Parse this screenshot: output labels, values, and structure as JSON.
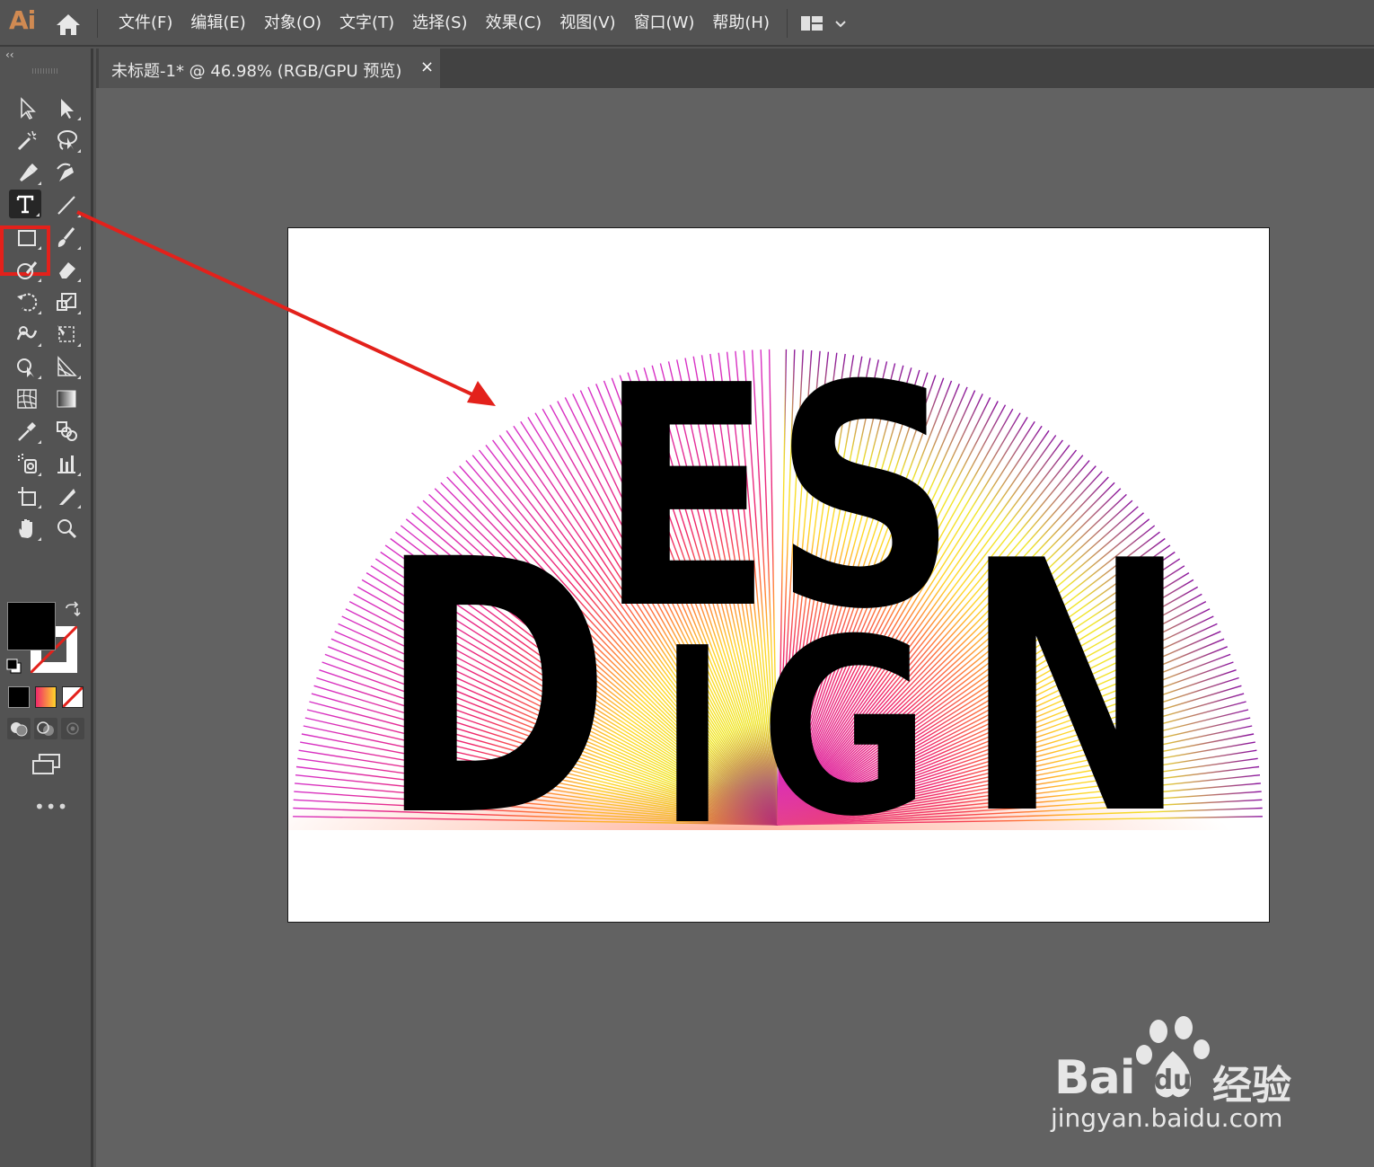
{
  "app": {
    "logo": "Ai",
    "menu": [
      "文件(F)",
      "编辑(E)",
      "对象(O)",
      "文字(T)",
      "选择(S)",
      "效果(C)",
      "视图(V)",
      "窗口(W)",
      "帮助(H)"
    ]
  },
  "document": {
    "tab_title": "未标题-1* @ 46.98% (RGB/GPU 预览)",
    "close_glyph": "×"
  },
  "toolbar": {
    "collapse_glyph": "‹‹",
    "more_glyph": "•••",
    "tools": [
      "selection-tool",
      "direct-selection-tool",
      "magic-wand-tool",
      "lasso-tool",
      "pen-tool",
      "curvature-tool",
      "type-tool",
      "line-segment-tool",
      "rectangle-tool",
      "paintbrush-tool",
      "shaper-tool",
      "eraser-tool",
      "rotate-tool",
      "scale-tool",
      "warp-tool",
      "free-transform-tool",
      "shape-builder-tool",
      "perspective-grid-tool",
      "mesh-tool",
      "gradient-tool",
      "eyedropper-tool",
      "blend-tool",
      "symbol-sprayer-tool",
      "column-graph-tool",
      "artboard-tool",
      "slice-tool",
      "hand-tool",
      "zoom-tool"
    ],
    "selected_tool": "type-tool",
    "fill_color": "#000000",
    "stroke_color": "none"
  },
  "artwork": {
    "top_letters": "ES",
    "bottom_letters": [
      "D",
      "I",
      "G",
      "N"
    ],
    "gradient_colors": [
      "#d631c9",
      "#f0286a",
      "#ff7a3a",
      "#ffd52a",
      "#f0e62a",
      "#8a12a0"
    ]
  },
  "watermark": {
    "brand": "Bai",
    "brand_cn": "经验",
    "url": "jingyan.baidu.com"
  },
  "colors": {
    "highlight": "#e3211b",
    "ui_bg": "#535353",
    "canvas_bg": "#626262"
  }
}
